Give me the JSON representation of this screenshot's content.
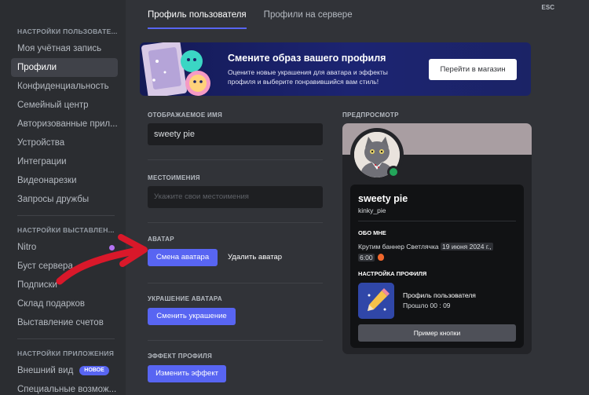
{
  "sidebar": {
    "user_heading": "НАСТРОЙКИ ПОЛЬЗОВАТЕ...",
    "user_items": [
      {
        "label": "Моя учётная запись"
      },
      {
        "label": "Профили"
      },
      {
        "label": "Конфиденциальность"
      },
      {
        "label": "Семейный центр"
      },
      {
        "label": "Авторизованные прил..."
      },
      {
        "label": "Устройства"
      },
      {
        "label": "Интеграции"
      },
      {
        "label": "Видеонарезки"
      },
      {
        "label": "Запросы дружбы"
      }
    ],
    "billing_heading": "НАСТРОЙКИ ВЫСТАВЛЕН...",
    "billing_items": [
      {
        "label": "Nitro"
      },
      {
        "label": "Буст сервера"
      },
      {
        "label": "Подписки"
      },
      {
        "label": "Склад подарков"
      },
      {
        "label": "Выставление счетов"
      }
    ],
    "app_heading": "НАСТРОЙКИ ПРИЛОЖЕНИЯ",
    "app_items": [
      {
        "label": "Внешний вид",
        "badge": "НОВОЕ"
      },
      {
        "label": "Специальные возмож..."
      }
    ]
  },
  "tabs": [
    {
      "label": "Профиль пользователя"
    },
    {
      "label": "Профили на сервере"
    }
  ],
  "esc_label": "ESC",
  "banner": {
    "title": "Смените образ вашего профиля",
    "description": "Оцените новые украшения для аватара и эффекты профиля и выберите понравившийся вам стиль!",
    "button": "Перейти в магазин"
  },
  "form": {
    "display_name_label": "ОТОБРАЖАЕМОЕ ИМЯ",
    "display_name_value": "sweety pie",
    "pronouns_label": "МЕСТОИМЕНИЯ",
    "pronouns_placeholder": "Укажите свои местоимения",
    "avatar_label": "АВАТАР",
    "change_avatar": "Смена аватара",
    "remove_avatar": "Удалить аватар",
    "decoration_label": "УКРАШЕНИЕ АВАТАРА",
    "change_decoration": "Сменить украшение",
    "effect_label": "ЭФФЕКТ ПРОФИЛЯ",
    "change_effect": "Изменить эффект"
  },
  "preview": {
    "label": "ПРЕДПРОСМОТР",
    "name": "sweety pie",
    "username": "kinky_pie",
    "about_heading": "ОБО МНЕ",
    "about_text_prefix": "Крутим баннер Светлячка",
    "about_highlight_date": "19 июня 2024 г.,",
    "about_highlight_time": "6:00",
    "activity_heading": "НАСТРОЙКА ПРОФИЛЯ",
    "activity_title": "Профиль пользователя",
    "activity_time": "Прошло 00 : 09",
    "example_button": "Пример кнопки"
  },
  "colors": {
    "accent": "#5865f2",
    "online": "#23a55a",
    "arrow": "#d9182a"
  }
}
